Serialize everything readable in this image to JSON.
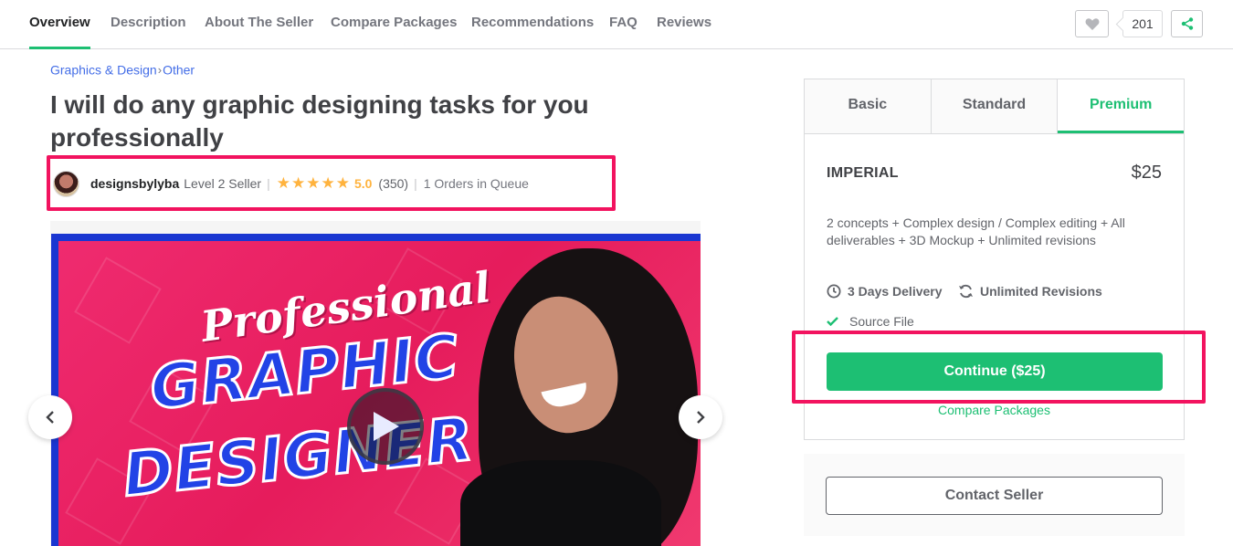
{
  "nav": {
    "tabs": [
      {
        "label": "Overview",
        "active": true
      },
      {
        "label": "Description"
      },
      {
        "label": "About The Seller"
      },
      {
        "label": "Compare Packages"
      },
      {
        "label": "Recommendations"
      },
      {
        "label": "FAQ"
      },
      {
        "label": "Reviews"
      }
    ],
    "like_count": "201"
  },
  "breadcrumb": {
    "category": "Graphics & Design",
    "separator": "›",
    "subcategory": "Other"
  },
  "gig": {
    "title": "I will do any graphic designing tasks for you professionally"
  },
  "seller": {
    "username": "designsbylyba",
    "level": "Level 2 Seller",
    "divider": "|",
    "stars": "★★★★★",
    "rating": "5.0",
    "review_count": "(350)",
    "queue": "1 Orders in Queue"
  },
  "gallery": {
    "line1": "Professional",
    "line2": "GRAPHIC",
    "line3": "DESIGNER"
  },
  "packages": {
    "tabs": [
      {
        "label": "Basic"
      },
      {
        "label": "Standard"
      },
      {
        "label": "Premium",
        "active": true
      }
    ],
    "selected": {
      "name": "IMPERIAL",
      "price": "$25",
      "description": "2 concepts + Complex design / Complex editing + All deliverables + 3D Mockup + Unlimited revisions",
      "delivery": "3 Days Delivery",
      "revisions": "Unlimited Revisions",
      "feature": "Source File"
    },
    "continue_label": "Continue ($25)",
    "compare_label": "Compare Packages"
  },
  "contact_label": "Contact Seller",
  "colors": {
    "accent": "#1dbf73",
    "highlight": "#f2135f",
    "star": "#ffb33e",
    "link": "#446ee7"
  }
}
